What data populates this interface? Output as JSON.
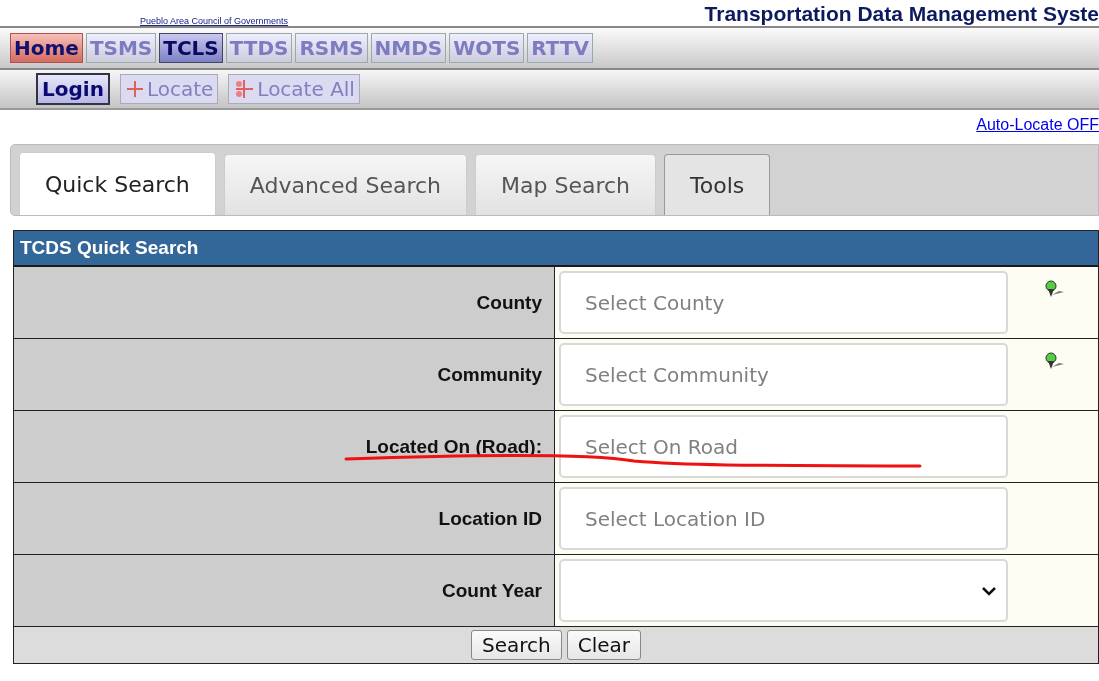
{
  "header": {
    "org": "Pueblo Area Council of Governments",
    "title": "Transportation Data Management Syste"
  },
  "nav": [
    {
      "label": "Home",
      "kind": "home",
      "selected": false,
      "disabled": false
    },
    {
      "label": "TSMS",
      "kind": "module",
      "selected": false,
      "disabled": true
    },
    {
      "label": "TCLS",
      "kind": "module",
      "selected": true,
      "disabled": false
    },
    {
      "label": "TTDS",
      "kind": "module",
      "selected": false,
      "disabled": true
    },
    {
      "label": "RSMS",
      "kind": "module",
      "selected": false,
      "disabled": true
    },
    {
      "label": "NMDS",
      "kind": "module",
      "selected": false,
      "disabled": true
    },
    {
      "label": "WOTS",
      "kind": "module",
      "selected": false,
      "disabled": true
    },
    {
      "label": "RTTV",
      "kind": "module",
      "selected": false,
      "disabled": true
    }
  ],
  "toolbar": [
    {
      "label": "Login",
      "kind": "login",
      "disabled": false
    },
    {
      "label": "Locate",
      "kind": "locate",
      "disabled": true
    },
    {
      "label": "Locate All",
      "kind": "locate_all",
      "disabled": true
    }
  ],
  "auto_locate_link": "Auto-Locate OFF",
  "tabs": [
    {
      "label": "Quick Search",
      "selected": true
    },
    {
      "label": "Advanced Search",
      "selected": false
    },
    {
      "label": "Map Search",
      "selected": false
    },
    {
      "label": "Tools",
      "selected": false
    }
  ],
  "form": {
    "title": "TCDS Quick Search",
    "rows": [
      {
        "label": "County",
        "kind": "input",
        "placeholder": "Select County",
        "pin": true,
        "underlined": false
      },
      {
        "label": "Community",
        "kind": "input",
        "placeholder": "Select Community",
        "pin": true,
        "underlined": false
      },
      {
        "label": "Located On (Road):",
        "kind": "input",
        "placeholder": "Select On Road",
        "pin": false,
        "underlined": true
      },
      {
        "label": "Location ID",
        "kind": "input",
        "placeholder": "Select Location ID",
        "pin": false,
        "underlined": false
      },
      {
        "label": "Count Year",
        "kind": "select",
        "placeholder": "",
        "pin": false,
        "underlined": false
      }
    ],
    "buttons": [
      "Search",
      "Clear"
    ]
  }
}
